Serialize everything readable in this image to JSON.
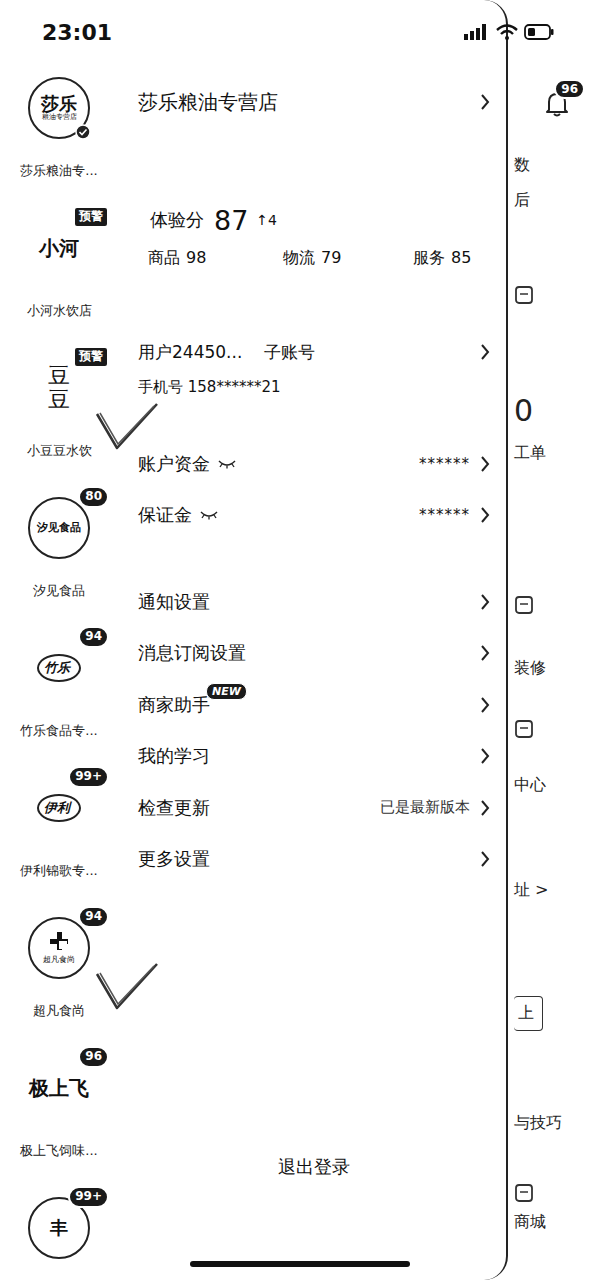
{
  "status_bar": {
    "time": "23:01"
  },
  "stores": [
    {
      "logo": "莎乐",
      "logo_sub": "粮油专营店",
      "logo_kind": "circle",
      "verified": true,
      "name": "莎乐粮油专...",
      "annotated": false
    },
    {
      "logo": "小河",
      "logo_kind": "plain",
      "badge": "预警",
      "badge_kind": "warning",
      "verified": false,
      "name": "小河水饮店",
      "annotated": false
    },
    {
      "logo": "豆豆",
      "logo_kind": "vertical",
      "badge": "预警",
      "badge_kind": "warning",
      "verified": false,
      "name": "小豆豆水饮",
      "annotated": true
    },
    {
      "logo": "汐见食品",
      "logo_kind": "circle",
      "badge": "80",
      "badge_kind": "score",
      "verified": false,
      "name": "汐见食品",
      "annotated": false
    },
    {
      "logo": "竹乐",
      "logo_kind": "oval",
      "badge": "94",
      "badge_kind": "score",
      "verified": false,
      "name": "竹乐食品专...",
      "annotated": false
    },
    {
      "logo": "伊利",
      "logo_kind": "oval",
      "badge": "99+",
      "badge_kind": "score",
      "verified": false,
      "name": "伊利锦歌专...",
      "annotated": false
    },
    {
      "logo": "超凡食尚",
      "logo_kind": "cross",
      "badge": "94",
      "badge_kind": "score",
      "verified": false,
      "name": "超凡食尚",
      "annotated": true
    },
    {
      "logo": "极上飞",
      "logo_kind": "plain",
      "badge": "96",
      "badge_kind": "score",
      "verified": false,
      "name": "极上飞饲味...",
      "annotated": false
    },
    {
      "logo": "丰",
      "logo_kind": "circle",
      "badge": "99+",
      "badge_kind": "score",
      "verified": false,
      "annotated": false
    }
  ],
  "account": {
    "store_name": "莎乐粮油专营店",
    "experience": {
      "label": "体验分",
      "score": "87",
      "change": "↑4"
    },
    "sub_scores": [
      {
        "label": "商品",
        "value": "98"
      },
      {
        "label": "物流",
        "value": "79"
      },
      {
        "label": "服务",
        "value": "85"
      }
    ],
    "user": {
      "name": "用户24450...",
      "role": "子账号",
      "phone": "手机号 158******21"
    },
    "funds": [
      {
        "label": "账户资金",
        "value": "******",
        "hidden": true
      },
      {
        "label": "保证金",
        "value": "******",
        "hidden": true
      }
    ],
    "menu": [
      {
        "label": "通知设置"
      },
      {
        "label": "消息订阅设置"
      },
      {
        "label": "商家助手",
        "badge": "NEW"
      },
      {
        "label": "我的学习"
      },
      {
        "label": "检查更新",
        "value": "已是最新版本"
      },
      {
        "label": "更多设置"
      }
    ],
    "logout": "退出登录"
  },
  "background": {
    "bell_badge": "96",
    "fragments": [
      {
        "kind": "text",
        "text": "数"
      },
      {
        "kind": "text",
        "text": "后"
      },
      {
        "kind": "icon"
      },
      {
        "kind": "big",
        "text": "0"
      },
      {
        "kind": "text",
        "text": "工单"
      },
      {
        "kind": "icon"
      },
      {
        "kind": "text",
        "text": "装修"
      },
      {
        "kind": "icon"
      },
      {
        "kind": "text",
        "text": "中心"
      },
      {
        "kind": "text",
        "text": "址 >"
      },
      {
        "kind": "boxed",
        "text": "上"
      },
      {
        "kind": "text",
        "text": "与技巧"
      },
      {
        "kind": "icon"
      },
      {
        "kind": "text",
        "text": "商城"
      }
    ]
  }
}
